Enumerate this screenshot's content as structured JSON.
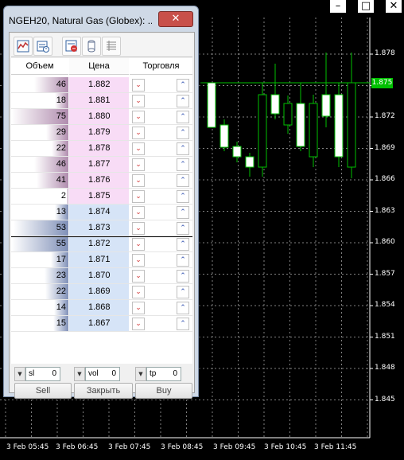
{
  "window_controls": {
    "minimize": "–",
    "maximize": "□",
    "close": "✕"
  },
  "chart": {
    "colors": {
      "grid": "#808080",
      "candle": "#00c000",
      "current_line": "#00c000",
      "bull_body": "#ffffff",
      "bear_body": "#000000"
    },
    "price_labels": [
      "1.878",
      "1.875",
      "1.872",
      "1.869",
      "1.866",
      "1.863",
      "1.860",
      "1.857",
      "1.854",
      "1.851",
      "1.848",
      "1.845"
    ],
    "current_price": "1.875",
    "time_labels": [
      "3 Feb 05:45",
      "3 Feb 06:45",
      "3 Feb 07:45",
      "3 Feb 08:45",
      "3 Feb 09:45",
      "3 Feb 10:45",
      "3 Feb 11:45"
    ]
  },
  "dom": {
    "title": "NGEH20, Natural Gas (Globex): ...",
    "close_label": "✕",
    "toolbar_icons": [
      "chart-icon",
      "history-icon",
      "orders-icon",
      "cylinder-icon",
      "list-icon"
    ],
    "headers": {
      "volume": "Объем",
      "price": "Цена",
      "trade": "Торговля"
    },
    "asks": [
      {
        "volume": "46",
        "price": "1.882",
        "fill": 0.6
      },
      {
        "volume": "18",
        "price": "1.881",
        "fill": 0.24
      },
      {
        "volume": "75",
        "price": "1.880",
        "fill": 1.0
      },
      {
        "volume": "29",
        "price": "1.879",
        "fill": 0.39
      },
      {
        "volume": "22",
        "price": "1.878",
        "fill": 0.29
      },
      {
        "volume": "46",
        "price": "1.877",
        "fill": 0.6
      },
      {
        "volume": "41",
        "price": "1.876",
        "fill": 0.55
      },
      {
        "volume": "2",
        "price": "1.875",
        "fill": 0.03
      }
    ],
    "bids": [
      {
        "volume": "13",
        "price": "1.874",
        "fill": 0.24
      },
      {
        "volume": "53",
        "price": "1.873",
        "fill": 0.96
      },
      {
        "volume": "55",
        "price": "1.872",
        "fill": 1.0
      },
      {
        "volume": "17",
        "price": "1.871",
        "fill": 0.31
      },
      {
        "volume": "23",
        "price": "1.870",
        "fill": 0.42
      },
      {
        "volume": "22",
        "price": "1.869",
        "fill": 0.4
      },
      {
        "volume": "14",
        "price": "1.868",
        "fill": 0.25
      },
      {
        "volume": "15",
        "price": "1.867",
        "fill": 0.27
      }
    ],
    "sell_arrow": "⌄",
    "buy_arrow": "⌃",
    "controls": {
      "sl_label": "sl",
      "sl_value": "0",
      "vol_label": "vol",
      "vol_value": "0",
      "tp_label": "tp",
      "tp_value": "0",
      "spin_arrow": "▼"
    },
    "buttons": {
      "sell": "Sell",
      "close": "Закрыть",
      "buy": "Buy"
    }
  }
}
